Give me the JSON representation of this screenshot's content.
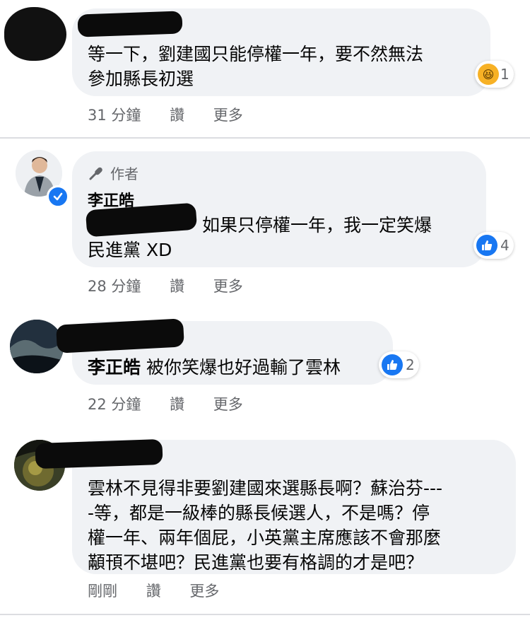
{
  "colors": {
    "bubble": "#f0f2f5",
    "meta": "#65676b",
    "like": "#1877f2",
    "haha": "#f7b125"
  },
  "comments": [
    {
      "author": "",
      "mention": "",
      "text_lines": [
        "等一下，劉建國只能停權一年，要不然無法",
        "參加縣長初選"
      ],
      "reaction": {
        "icon": "haha-icon",
        "count": "1"
      },
      "meta": {
        "time": "31 分鐘",
        "like": "讚",
        "more": "更多"
      }
    },
    {
      "badge": "作者",
      "author": "李正皓",
      "mention": "",
      "text_lines": [
        "如果只停權一年，我一定笑爆",
        "民進黨 XD"
      ],
      "reaction": {
        "icon": "like-icon",
        "count": "4"
      },
      "meta": {
        "time": "28 分鐘",
        "like": "讚",
        "more": "更多"
      }
    },
    {
      "author": "",
      "mention": "李正皓",
      "text_lines": [
        "被你笑爆也好過輸了雲林"
      ],
      "reaction": {
        "icon": "like-icon",
        "count": "2"
      },
      "meta": {
        "time": "22 分鐘",
        "like": "讚",
        "more": "更多"
      }
    },
    {
      "author": "",
      "mention": "",
      "text_lines": [
        "雲林不見得非要劉建國來選縣長啊？蘇治芬---",
        "-等，都是一級棒的縣長候選人，不是嗎？停",
        "權一年、兩年個屁，小英黨主席應該不會那麼",
        "顢頇不堪吧？民進黨也要有格調的才是吧？"
      ],
      "reaction": null,
      "meta": {
        "time": "剛剛",
        "like": "讚",
        "more": "更多"
      }
    }
  ]
}
